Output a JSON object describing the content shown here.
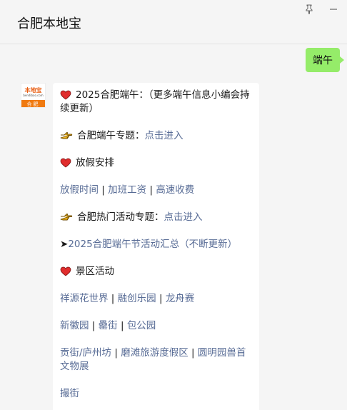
{
  "window": {
    "title": "合肥本地宝"
  },
  "outgoing": {
    "text": "端午"
  },
  "avatar": {
    "logo_main": "本地宝",
    "logo_sub": "bendibao.com",
    "city": "合肥"
  },
  "message": {
    "line1_text": "2025合肥端午：（更多端午信息小编会持续更新）",
    "line2_prefix": "合肥端午专题：",
    "line2_link": "点击进入",
    "line3_text": "放假安排",
    "line4_links": [
      "放假时间",
      "加班工资",
      "高速收费"
    ],
    "separator": "|",
    "line5_prefix": "合肥热门活动专题：",
    "line5_link": "点击进入",
    "line6_arrow": "➤",
    "line6_link": "2025合肥端午节活动汇总（不断更新）",
    "line7_text": "景区活动",
    "line8_links": [
      "祥源花世界",
      "融创乐园",
      "龙舟赛"
    ],
    "line9_links": [
      "新徽园",
      "罍街",
      "包公园"
    ],
    "line10_links": [
      "贡街/庐州坊",
      "磨滩旅游度假区",
      "圆明园兽首文物展"
    ],
    "line11_link": "撮街"
  },
  "icons": {
    "heart": "heart-icon",
    "hand": "pointing-hand-icon",
    "pin": "pin-icon",
    "minimize": "minimize-icon"
  },
  "colors": {
    "bubble_out": "#95ec69",
    "link": "#576b95",
    "heart": "#e02d2d",
    "hand": "#f2b61d",
    "avatar_orange": "#f07a10"
  }
}
